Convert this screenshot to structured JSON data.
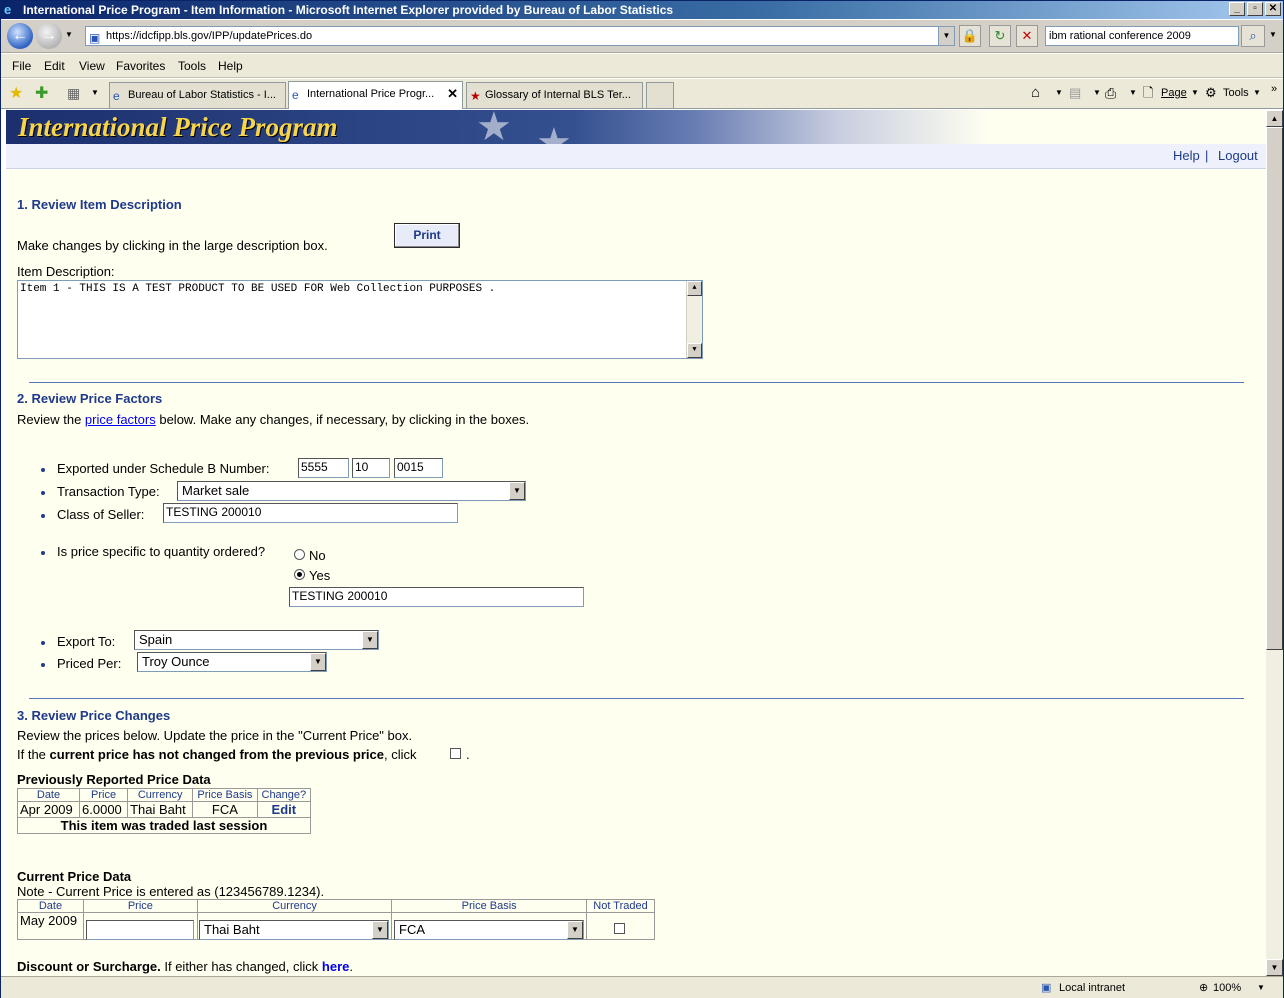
{
  "window": {
    "title": "International Price Program - Item Information - Microsoft Internet Explorer provided by Bureau of Labor Statistics",
    "address": "https://idcfipp.bls.gov/IPP/updatePrices.do",
    "search_text": "ibm rational conference 2009"
  },
  "menu": [
    "File",
    "Edit",
    "View",
    "Favorites",
    "Tools",
    "Help"
  ],
  "tabs": [
    {
      "label": "Bureau of Labor Statistics - I..."
    },
    {
      "label": "International Price Progr..."
    },
    {
      "label": "Glossary of Internal BLS Ter..."
    }
  ],
  "command_bar": {
    "page": "Page",
    "tools": "Tools"
  },
  "banner": {
    "title": "International Price Program"
  },
  "top_links": {
    "help": "Help",
    "separator": "|",
    "logout": "Logout"
  },
  "section1": {
    "heading": "1. Review Item Description",
    "instruction": "Make changes by clicking in the large description box.",
    "print_label": "Print",
    "item_desc_label": "Item Description:",
    "item_desc_value": "Item 1 - THIS IS A TEST PRODUCT TO BE USED FOR Web Collection PURPOSES ."
  },
  "section2": {
    "heading": "2. Review Price Factors",
    "intro_before": "Review the ",
    "intro_link": "price factors",
    "intro_after": " below. Make any changes, if necessary, by clicking in the boxes.",
    "schedule_b_label": "Exported under Schedule B Number:",
    "schedule_b": [
      "5555",
      "10",
      "0015"
    ],
    "transaction_type_label": "Transaction Type:",
    "transaction_type": "Market sale",
    "class_of_seller_label": "Class of Seller:",
    "class_of_seller": "TESTING 200010",
    "qty_question": "Is price specific to quantity ordered?",
    "qty_no": "No",
    "qty_yes": "Yes",
    "qty_selected": "Yes",
    "qty_value": "TESTING 200010",
    "export_to_label": "Export To:",
    "export_to": "Spain",
    "priced_per_label": "Priced Per:",
    "priced_per": "Troy Ounce"
  },
  "section3": {
    "heading": "3. Review Price Changes",
    "line1": "Review the prices below. Update the price in the \"Current Price\" box.",
    "line2_before": "If the ",
    "line2_bold": "current price has not changed from the previous price",
    "line2_after": ", click",
    "line2_end": ".",
    "prev_heading": "Previously Reported Price Data",
    "prev_columns": [
      "Date",
      "Price",
      "Currency",
      "Price Basis",
      "Change?"
    ],
    "prev_row": {
      "date": "Apr 2009",
      "price": "6.0000",
      "currency": "Thai Baht",
      "basis": "FCA",
      "change": "Edit"
    },
    "prev_footer": "This item was traded last session",
    "current_heading": "Current Price Data",
    "current_note": "Note - Current Price is entered as (123456789.1234).",
    "current_columns": [
      "Date",
      "Price",
      "Currency",
      "Price Basis",
      "Not Traded"
    ],
    "current_row": {
      "date": "May 2009",
      "price": "",
      "currency": "Thai Baht",
      "basis": "FCA"
    },
    "discount_bold": "Discount or Surcharge.",
    "discount_text": " If either has changed, click ",
    "discount_link": "here",
    "discount_end": "."
  },
  "status": {
    "zone": "Local intranet",
    "zoom": "100%"
  }
}
